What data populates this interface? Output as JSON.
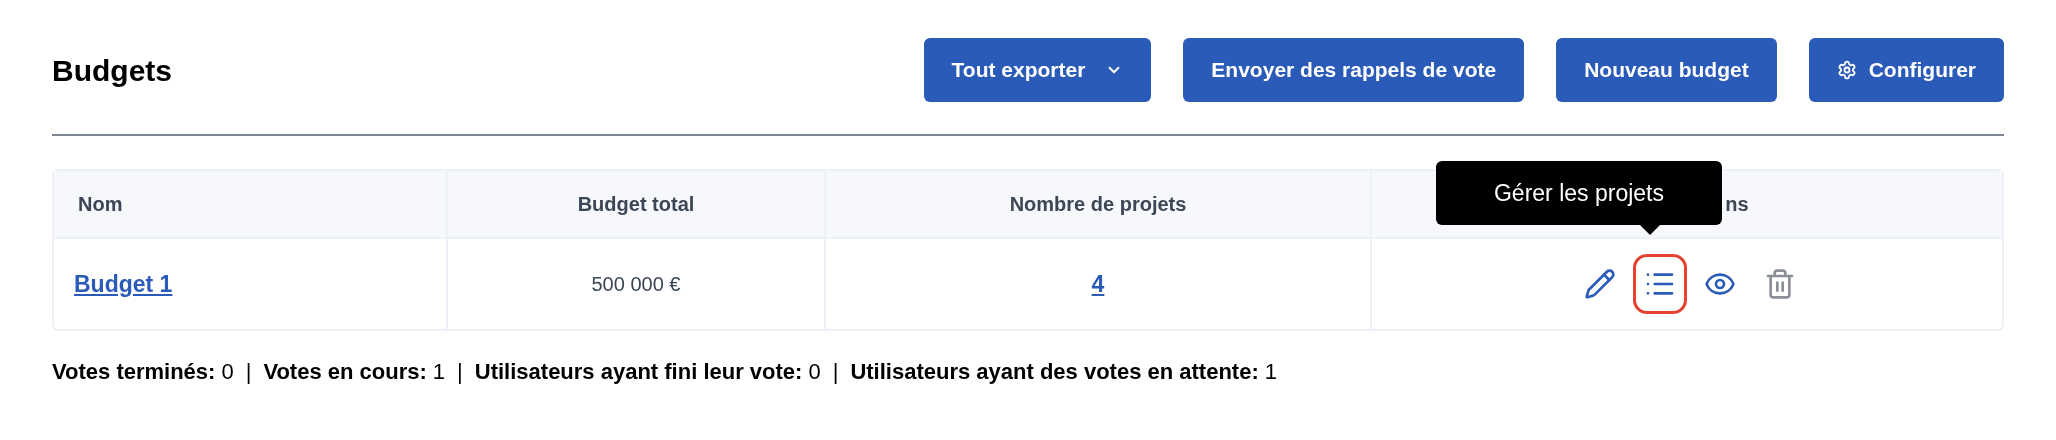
{
  "title": "Budgets",
  "buttons": [
    {
      "label": "Tout exporter",
      "kind": "dropdown"
    },
    {
      "label": "Envoyer des rappels de vote",
      "kind": "plain"
    },
    {
      "label": "Nouveau budget",
      "kind": "plain"
    },
    {
      "label": "Configurer",
      "kind": "settings"
    }
  ],
  "table": {
    "columns": [
      "Nom",
      "Budget total",
      "Nombre de projets",
      "ns"
    ],
    "rows": [
      {
        "name": "Budget 1",
        "total": "500 000 €",
        "projects": "4",
        "actions": [
          {
            "kind": "edit",
            "highlighted": false
          },
          {
            "kind": "list",
            "highlighted": true
          },
          {
            "kind": "view",
            "highlighted": false
          },
          {
            "kind": "delete",
            "highlighted": false
          }
        ]
      }
    ]
  },
  "tooltip": {
    "text": "Gérer les projets"
  },
  "stats": {
    "separator": "|",
    "items": [
      {
        "label": "Votes terminés:",
        "value": "0"
      },
      {
        "label": "Votes en cours:",
        "value": "1"
      },
      {
        "label": "Utilisateurs ayant fini leur vote:",
        "value": "0"
      },
      {
        "label": "Utilisateurs ayant des votes en attente:",
        "value": "1"
      }
    ]
  }
}
